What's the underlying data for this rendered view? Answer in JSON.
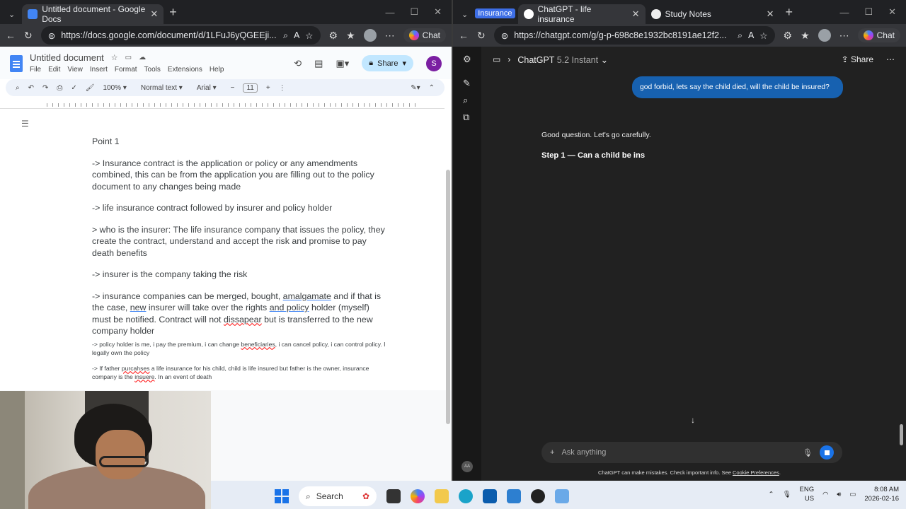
{
  "left_window": {
    "tab": {
      "title": "Untitled document - Google Docs"
    },
    "url": "https://docs.google.com/document/d/1LFuJ6yQGEEji...",
    "chat_label": "Chat",
    "docs": {
      "title": "Untitled document",
      "menus": [
        "File",
        "Edit",
        "View",
        "Insert",
        "Format",
        "Tools",
        "Extensions",
        "Help"
      ],
      "share_label": "Share",
      "avatar_letter": "S",
      "toolbar": {
        "zoom": "100%",
        "style": "Normal text",
        "font": "Arial",
        "size": "11"
      },
      "outline_icon": "list-icon",
      "content": {
        "heading": "Point 1",
        "p1": "-> Insurance contract is the application or policy or any amendments combined, this can be from the application you are filling out to the policy document to any changes being made",
        "p2": "-> life insurance contract followed by insurer and policy holder",
        "p3": "> who is the insurer: The life insurance company that issues the policy, they create the contract, understand and accept the risk and promise to pay death benefits",
        "p4": "-> insurer is the company taking the risk",
        "p5a": "-> insurance companies can be merged, bought, ",
        "p5b": "amalgamate",
        "p5c": " and if that is the case, ",
        "p5d": "new",
        "p5e": " insurer will take over the rights ",
        "p5f": "and policy",
        "p5g": " holder (myself) must be notified. Contract will not ",
        "p5h": "dissapear",
        "p5i": " but is transferred to the new company holder",
        "p6a": "-> policy holder is me, i pay the premium, i can change ",
        "p6b": "beneficiaries",
        "p6c": ", i can cancel policy, i can control policy. I legally own the policy",
        "p7a": "-> If father ",
        "p7b": "purcahses",
        "p7c": " a life insurance for his child, child is life insured but father is the owner, insurance company is the ",
        "p7d": "insuere",
        "p7e": ". In an event of death"
      }
    }
  },
  "right_window": {
    "tabs": [
      {
        "label": "Insurance"
      },
      {
        "label": "ChatGPT - life insurance"
      },
      {
        "label": "Study Notes"
      }
    ],
    "url": "https://chatgpt.com/g/g-p-698c8e1932bc8191ae12f2...",
    "chat_label": "Chat",
    "chatgpt": {
      "header": {
        "model_name": "ChatGPT",
        "model_version": "5.2 Instant",
        "share_label": "Share"
      },
      "user_message": "god forbid, lets say the child died, will the child be insured?",
      "response_line1": "Good question. Let's go carefully.",
      "response_heading": "Step 1 — Can a child be ins",
      "composer_placeholder": "Ask anything",
      "disclaimer": "ChatGPT can make mistakes. Check important info. See ",
      "disclaimer_link": "Cookie Preferences",
      "disclaimer_end": "."
    }
  },
  "taskbar": {
    "search_label": "Search",
    "language": "ENG",
    "region": "US",
    "time": "8:08 AM",
    "date": "2026-02-16"
  }
}
